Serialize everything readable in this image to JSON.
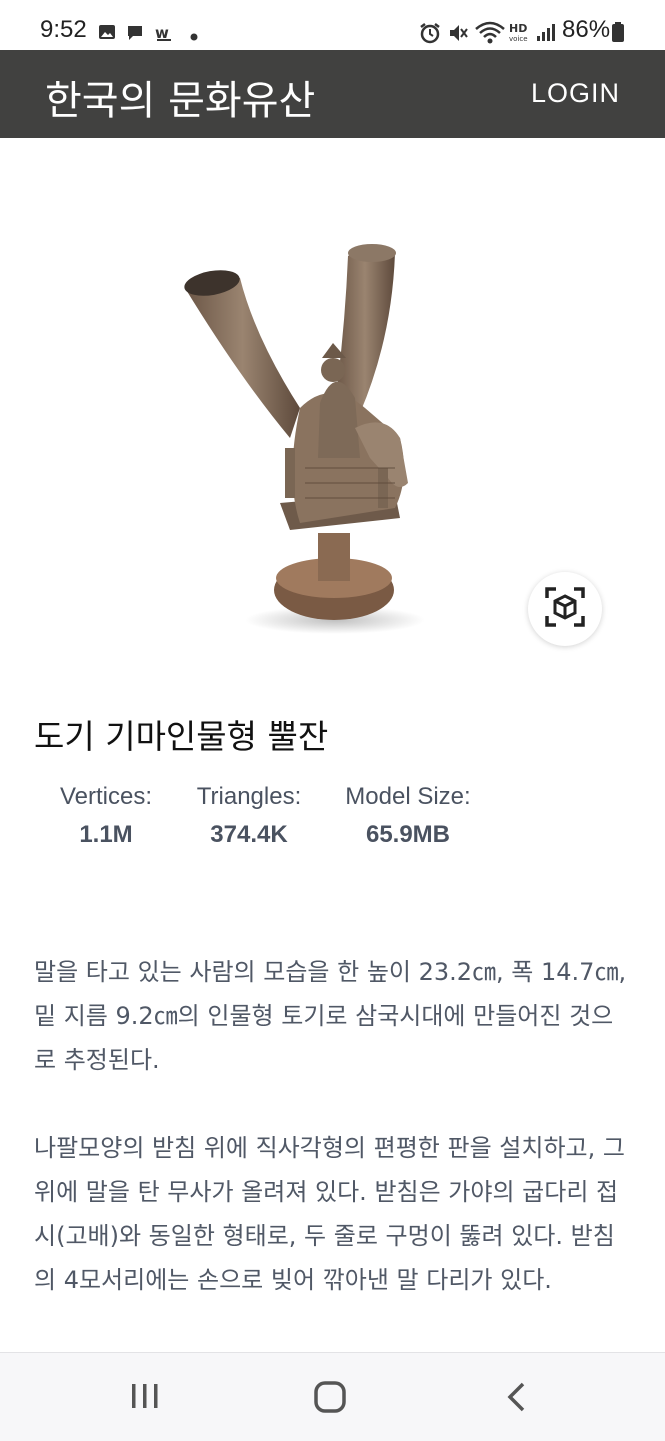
{
  "status": {
    "time": "9:52",
    "battery": "86%"
  },
  "appbar": {
    "title": "한국의 문화유산",
    "login": "LOGIN"
  },
  "object": {
    "title": "도기 기마인물형 뿔잔",
    "stats": [
      {
        "label": "Vertices:",
        "value": "1.1M"
      },
      {
        "label": "Triangles:",
        "value": "374.4K"
      },
      {
        "label": "Model Size:",
        "value": "65.9MB"
      }
    ],
    "description": [
      "말을 타고 있는 사람의 모습을 한 높이 23.2㎝, 폭 14.7㎝, 밑 지름 9.2㎝의 인물형 토기로 삼국시대에 만들어진 것으로 추정된다.",
      "나팔모양의 받침 위에 직사각형의 편평한 판을 설치하고, 그 위에 말을 탄 무사가 올려져 있다. 받침은 가야의 굽다리 접시(고배)와 동일한 형태로, 두 줄로 구멍이 뚫려 있다. 받침의 4모서리에는 손으로 빚어 깎아낸 말 다리가 있다."
    ]
  },
  "icons": [
    "gallery-icon",
    "message-icon",
    "w-app-icon",
    "dot-icon",
    "alarm-icon",
    "mute-icon",
    "wifi-icon",
    "hd-voice-icon",
    "signal-icon",
    "battery-icon",
    "ar-cube-icon",
    "recent-apps-icon",
    "home-icon",
    "back-icon"
  ],
  "colors": {
    "appbar": "#414140",
    "text_body": "#505866",
    "pottery": "#8a7462"
  }
}
